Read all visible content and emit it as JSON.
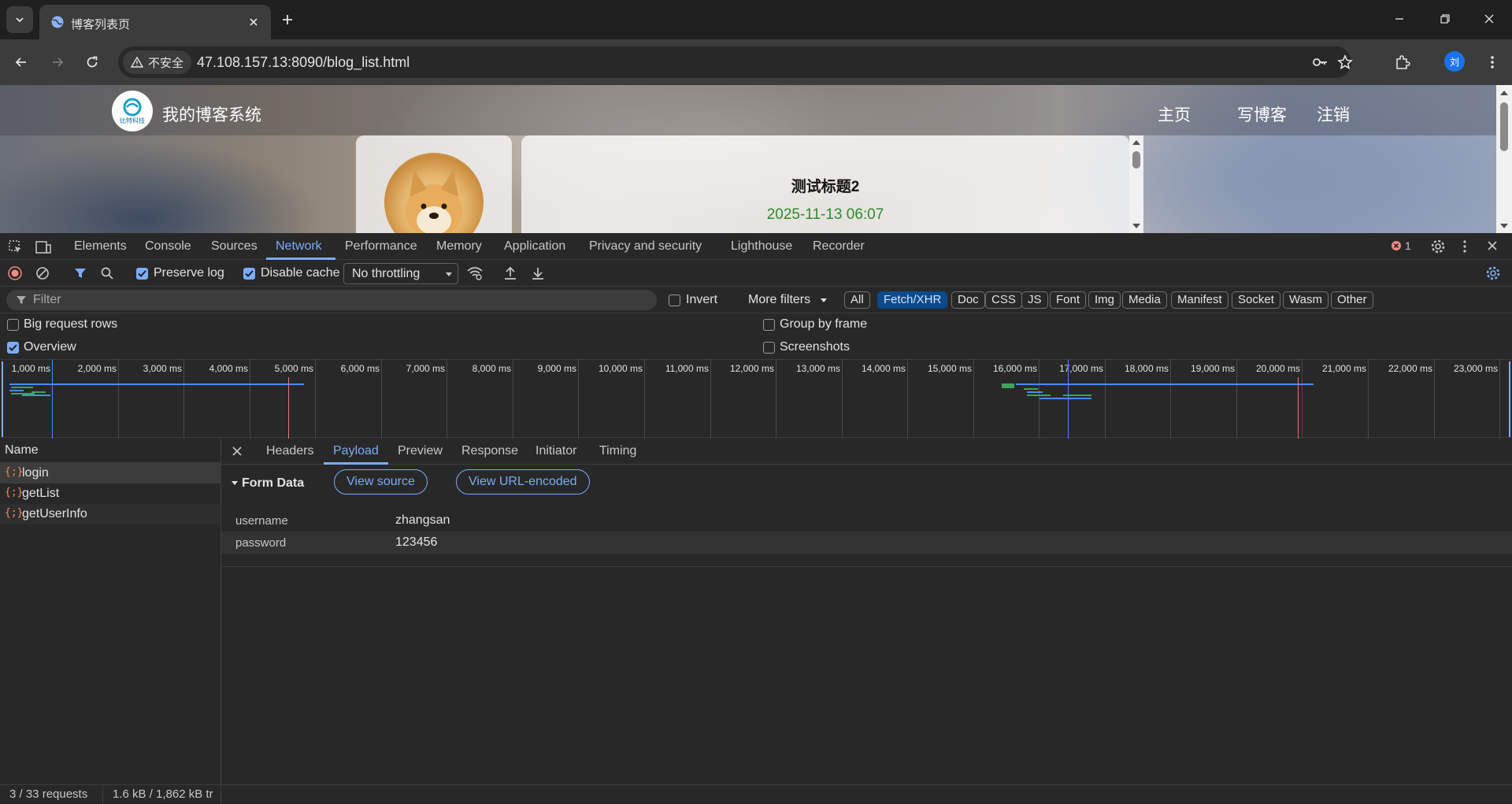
{
  "browser": {
    "tab_title": "博客列表页",
    "security_label": "不安全",
    "url": "47.108.157.13:8090/blog_list.html",
    "profile_initial": "刘"
  },
  "page": {
    "site_title": "我的博客系统",
    "logo_text": "比特科技",
    "nav_links": [
      "主页",
      "写博客",
      "注销"
    ],
    "blog_title": "测试标题2",
    "blog_date": "2025-11-13 06:07"
  },
  "devtools": {
    "tabs": [
      "Elements",
      "Console",
      "Sources",
      "Network",
      "Performance",
      "Memory",
      "Application",
      "Privacy and security",
      "Lighthouse",
      "Recorder"
    ],
    "active_tab": "Network",
    "error_count": "1",
    "toolbar": {
      "preserve_log": "Preserve log",
      "disable_cache": "Disable cache",
      "throttling": "No throttling"
    },
    "filter": {
      "placeholder": "Filter",
      "invert": "Invert",
      "more_filters": "More filters",
      "types": [
        "All",
        "Fetch/XHR",
        "Doc",
        "CSS",
        "JS",
        "Font",
        "Img",
        "Media",
        "Manifest",
        "Socket",
        "Wasm",
        "Other"
      ],
      "active_type": "Fetch/XHR"
    },
    "options": {
      "big_request_rows": "Big request rows",
      "overview": "Overview",
      "group_by_frame": "Group by frame",
      "screenshots": "Screenshots"
    },
    "timeline_ticks": [
      "1,000 ms",
      "2,000 ms",
      "3,000 ms",
      "4,000 ms",
      "5,000 ms",
      "6,000 ms",
      "7,000 ms",
      "8,000 ms",
      "9,000 ms",
      "10,000 ms",
      "11,000 ms",
      "12,000 ms",
      "13,000 ms",
      "14,000 ms",
      "15,000 ms",
      "16,000 ms",
      "17,000 ms",
      "18,000 ms",
      "19,000 ms",
      "20,000 ms",
      "21,000 ms",
      "22,000 ms",
      "23,000 ms"
    ],
    "requests": {
      "header": "Name",
      "items": [
        "login",
        "getList",
        "getUserInfo"
      ],
      "selected": "login"
    },
    "detail": {
      "tabs": [
        "Headers",
        "Payload",
        "Preview",
        "Response",
        "Initiator",
        "Timing"
      ],
      "active_tab": "Payload",
      "section_title": "Form Data",
      "view_source": "View source",
      "view_url_encoded": "View URL-encoded",
      "fields": [
        {
          "key": "username",
          "value": "zhangsan"
        },
        {
          "key": "password",
          "value": "123456"
        }
      ]
    },
    "status": {
      "requests": "3 / 33 requests",
      "transferred": "1.6 kB / 1,862 kB tr"
    }
  }
}
